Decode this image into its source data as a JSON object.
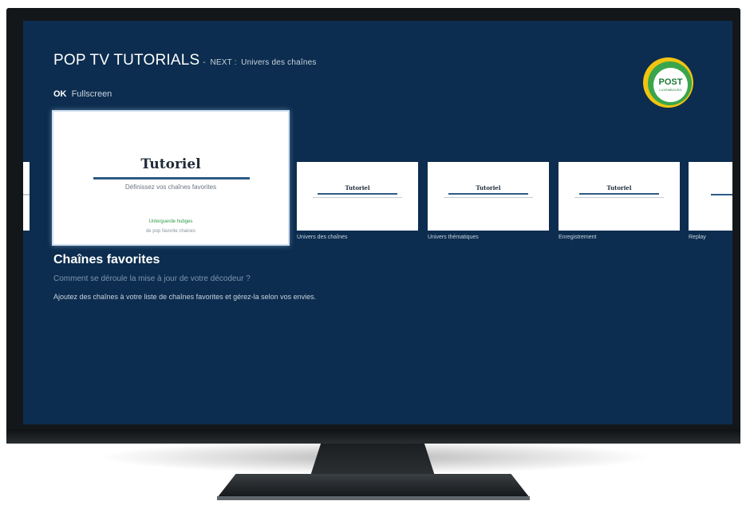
{
  "header": {
    "title": "POP TV TUTORIALS",
    "separator": "-",
    "next_label": "NEXT :",
    "next_value": "Univers des chaînes"
  },
  "hint": {
    "key": "OK",
    "label": "Fullscreen"
  },
  "logo": {
    "text": "POST",
    "subtext": "LUXEMBOURG",
    "colors": {
      "outer": "#f1c40f",
      "ring": "#3aa64b",
      "text": "#1f7a38"
    }
  },
  "selected_card": {
    "title": "Tutoriel",
    "subtitle": "Définissez vos chaînes favorites",
    "highlight": "Unterguerde hubges",
    "note": "de pop favorite chaines"
  },
  "carousel": [
    {
      "title": "Tutoriel",
      "caption": "Univers des chaînes"
    },
    {
      "title": "Tutoriel",
      "caption": "Univers thématiques"
    },
    {
      "title": "Tutoriel",
      "caption": "Enregistrement"
    },
    {
      "title": "",
      "caption": "Replay"
    }
  ],
  "section": {
    "title": "Chaînes favorites",
    "question": "Comment se déroule la mise à jour de votre décodeur ?",
    "description": "Ajoutez des chaînes à votre liste de chaînes favorites et gérez-la selon vos envies."
  },
  "colors": {
    "screen_background": "#0c2d4f",
    "accent_rule": "#2d5b85",
    "highlight_green": "#2e9b48"
  }
}
